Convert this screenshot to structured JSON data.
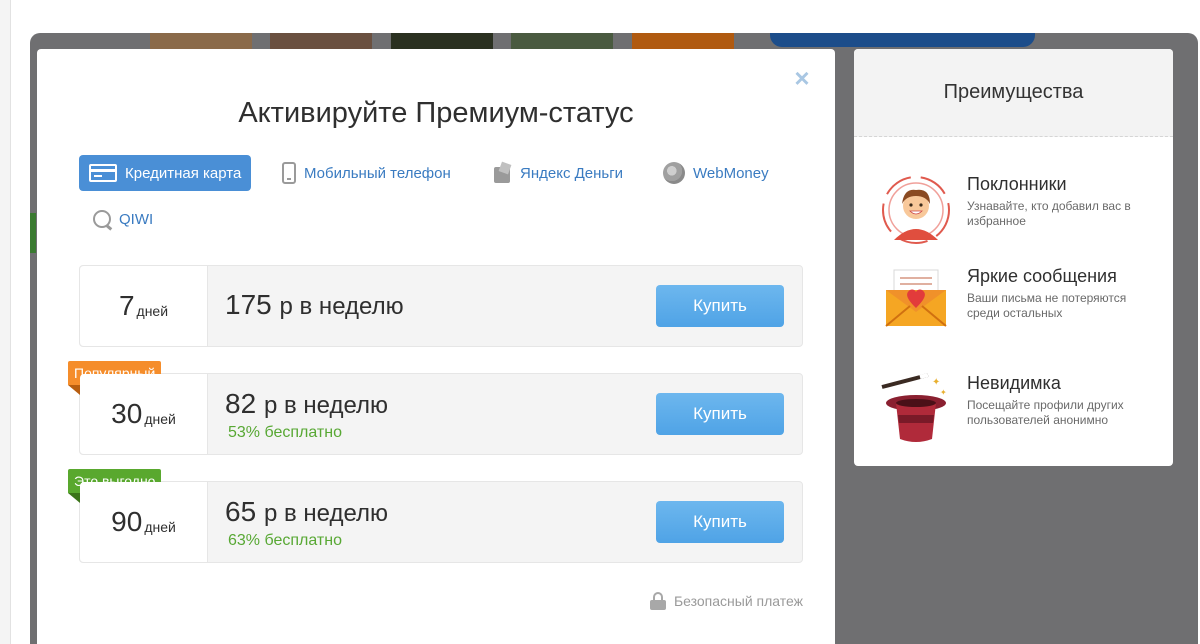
{
  "modal": {
    "title": "Активируйте Премиум-статус",
    "close_label": "×",
    "payment_methods": [
      {
        "label": "Кредитная карта",
        "icon": "credit-card-icon",
        "active": true
      },
      {
        "label": "Мобильный телефон",
        "icon": "mobile-phone-icon",
        "active": false
      },
      {
        "label": "Яндекс Деньги",
        "icon": "yandex-money-icon",
        "active": false
      },
      {
        "label": "WebMoney",
        "icon": "webmoney-icon",
        "active": false
      },
      {
        "label": "QIWI",
        "icon": "qiwi-icon",
        "active": false
      }
    ],
    "plans": [
      {
        "days": "7",
        "days_unit": "дней",
        "price": "175",
        "price_unit": "р в неделю",
        "discount": "",
        "badge": "",
        "buy_label": "Купить"
      },
      {
        "days": "30",
        "days_unit": "дней",
        "price": "82",
        "price_unit": "р в неделю",
        "discount": "53% бесплатно",
        "badge": "Популярный",
        "buy_label": "Купить"
      },
      {
        "days": "90",
        "days_unit": "дней",
        "price": "65",
        "price_unit": "р в неделю",
        "discount": "63% бесплатно",
        "badge": "Это выгодно",
        "buy_label": "Купить"
      }
    ],
    "secure_label": "Безопасный платеж"
  },
  "benefits": {
    "title": "Преимущества",
    "items": [
      {
        "title": "Поклонники",
        "description": "Узнавайте, кто добавил вас в избранное",
        "icon": "fan-avatar-icon"
      },
      {
        "title": "Яркие сообщения",
        "description": "Ваши письма не потеряются среди остальных",
        "icon": "love-letter-icon"
      },
      {
        "title": "Невидимка",
        "description": "Посещайте профили других пользователей анонимно",
        "icon": "magic-hat-icon"
      }
    ]
  },
  "colors": {
    "accent": "#4a8fd6",
    "buy_button": "#5aabea",
    "badge_popular": "#f58d2b",
    "badge_profitable": "#59a82e",
    "discount_text": "#58a834"
  }
}
